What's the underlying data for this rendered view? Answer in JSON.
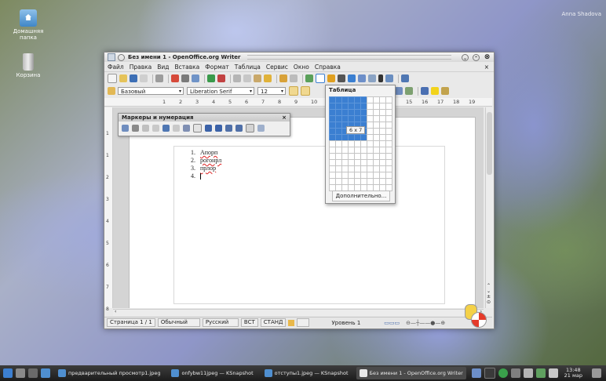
{
  "desktop": {
    "icons": [
      {
        "label": "Домашняя папка",
        "icon": "home-folder-icon"
      },
      {
        "label": "Корзина",
        "icon": "trash-icon"
      }
    ],
    "user": "Anna Shadova"
  },
  "window": {
    "title": "Без имени 1 - OpenOffice.org Writer",
    "menu": [
      "Файл",
      "Правка",
      "Вид",
      "Вставка",
      "Формат",
      "Таблица",
      "Сервис",
      "Окно",
      "Справка"
    ],
    "menu_close": "×",
    "formatting": {
      "style": "Базовый",
      "font": "Liberation Serif",
      "size": "12"
    },
    "ruler_ticks": [
      "1",
      "2",
      "3",
      "4",
      "5",
      "6",
      "7",
      "8",
      "9",
      "10",
      "15",
      "16",
      "17",
      "18",
      "19"
    ],
    "vruler_ticks": [
      "1",
      "1",
      "2",
      "3",
      "4",
      "5",
      "6",
      "7",
      "8"
    ],
    "document": {
      "list": [
        {
          "num": "1.",
          "text": "Апорп"
        },
        {
          "num": "2.",
          "text": "рогонрл"
        },
        {
          "num": "3.",
          "text": "прлор"
        },
        {
          "num": "4.",
          "text": ""
        }
      ]
    },
    "statusbar": {
      "page": "Страница 1 / 1",
      "style": "Обычный",
      "language": "Русский",
      "insert_mode": "ВСТ",
      "selection_mode": "СТАНД",
      "level": "Уровень 1"
    }
  },
  "bullets_toolbar": {
    "title": "Маркеры и нумерация",
    "close": "×"
  },
  "table_popup": {
    "title": "Таблица",
    "size_label": "6 x 7",
    "selected_cols": 6,
    "selected_rows": 7,
    "grid_cols": 10,
    "grid_rows": 15,
    "more_button": "Дополнительно..."
  },
  "taskbar": {
    "tasks": [
      {
        "label": "предварительный просмотр1.jpeg",
        "active": false
      },
      {
        "label": "onfybw11jpeg — KSnapshot",
        "active": false
      },
      {
        "label": "отступы1.jpeg — KSnapshot",
        "active": false
      },
      {
        "label": "Без имени 1 - OpenOffice.org Writer",
        "active": true
      }
    ],
    "time": "13:48",
    "date": "21 мар"
  },
  "colors": {
    "selection": "#3b7fd1",
    "taskbar": "#2a2a2a"
  }
}
